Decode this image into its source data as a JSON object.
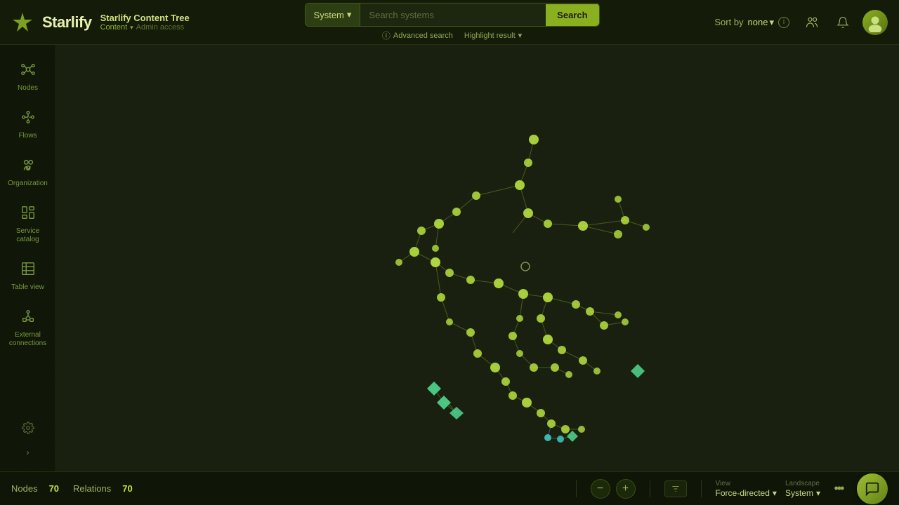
{
  "app": {
    "logo": "✦",
    "name": "Starlify",
    "breadcrumb": {
      "title": "Starlify Content Tree",
      "section": "Content",
      "access": "Admin access"
    }
  },
  "header": {
    "search": {
      "system_label": "System",
      "placeholder": "Search systems",
      "button_label": "Search",
      "advanced_label": "Advanced search",
      "highlight_label": "Highlight result"
    },
    "sort": {
      "label": "Sort by",
      "value": "none"
    }
  },
  "sidebar": {
    "items": [
      {
        "id": "nodes",
        "label": "Nodes",
        "icon": "⬡"
      },
      {
        "id": "flows",
        "label": "Flows",
        "icon": "⟳"
      },
      {
        "id": "organization",
        "label": "Organization",
        "icon": "👥"
      },
      {
        "id": "service-catalog",
        "label": "Service catalog",
        "icon": "📚"
      },
      {
        "id": "table-view",
        "label": "Table view",
        "icon": "▦"
      },
      {
        "id": "external-connections",
        "label": "External connections",
        "icon": "⚡"
      }
    ]
  },
  "status_bar": {
    "nodes_label": "Nodes",
    "nodes_count": "70",
    "relations_label": "Relations",
    "relations_count": "70",
    "view_label": "View",
    "view_value": "Force-directed",
    "landscape_label": "Landscape",
    "landscape_value": "System"
  },
  "colors": {
    "bg": "#1a2010",
    "node_main": "#b8e040",
    "node_teal": "#40c8c0",
    "node_diamond": "#50d890",
    "edge": "rgba(160, 200, 60, 0.4)",
    "accent": "#8ab020"
  }
}
